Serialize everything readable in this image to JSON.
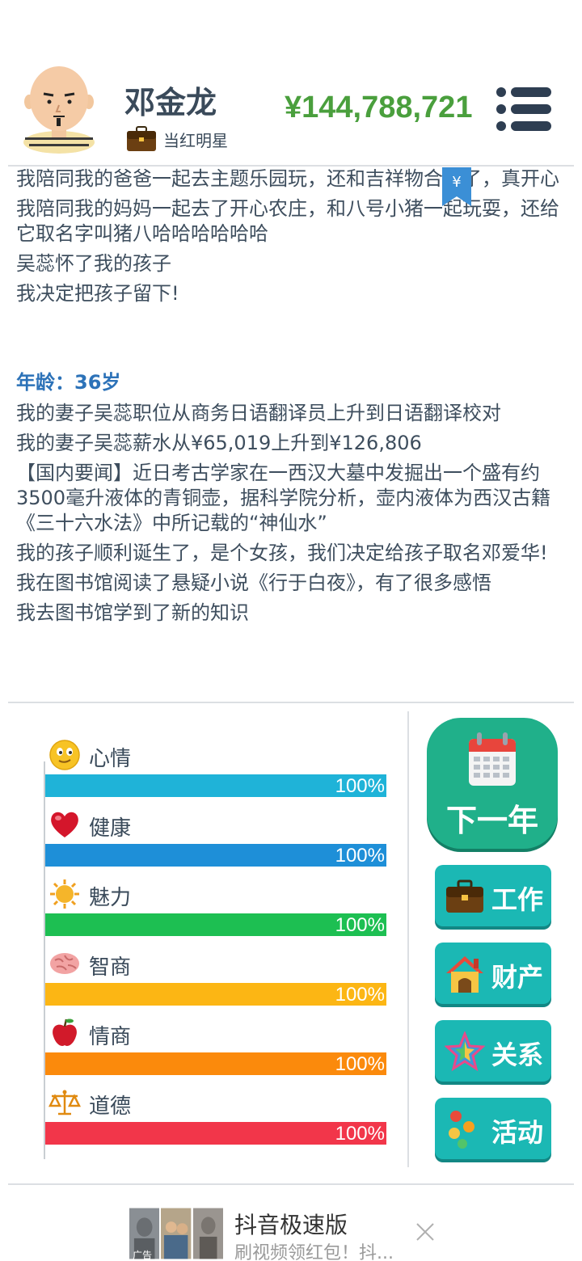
{
  "header": {
    "name": "邓金龙",
    "job_title": "当红明星",
    "money": "¥144,788,721"
  },
  "bookmark_symbol": "¥",
  "log": {
    "entries_before": [
      "我陪同我的爸爸一起去主题乐园玩，还和吉祥物合影了，真开心",
      "我陪同我的妈妈一起去了开心农庄，和八号小猪一起玩耍，还给它取名字叫猪八哈哈哈哈哈哈",
      "吴蕊怀了我的孩子",
      "我决定把孩子留下!"
    ],
    "age_label": "年龄：36岁",
    "entries_after": [
      "我的妻子吴蕊职位从商务日语翻译员上升到日语翻译校对",
      "我的妻子吴蕊薪水从¥65,019上升到¥126,806",
      "【国内要闻】近日考古学家在一西汉大墓中发掘出一个盛有约3500毫升液体的青铜壶，据科学院分析，壶内液体为西汉古籍《三十六水法》中所记载的“神仙水”",
      "我的孩子顺利诞生了，是个女孩，我们决定给孩子取名邓爱华!",
      "我在图书馆阅读了悬疑小说《行于白夜》，有了很多感悟",
      "我去图书馆学到了新的知识"
    ]
  },
  "stats": [
    {
      "name": "心情",
      "value": "100%",
      "fraction": 1.0,
      "color": "#1fb3d8",
      "icon": "smiley-icon"
    },
    {
      "name": "健康",
      "value": "100%",
      "fraction": 1.0,
      "color": "#1e8fd8",
      "icon": "heart-icon"
    },
    {
      "name": "魅力",
      "value": "100%",
      "fraction": 1.0,
      "color": "#1dbf52",
      "icon": "sun-icon"
    },
    {
      "name": "智商",
      "value": "100%",
      "fraction": 1.0,
      "color": "#fcb614",
      "icon": "brain-icon"
    },
    {
      "name": "情商",
      "value": "100%",
      "fraction": 1.0,
      "color": "#fb8a0c",
      "icon": "apple-icon"
    },
    {
      "name": "道德",
      "value": "100%",
      "fraction": 1.0,
      "color": "#f2364a",
      "icon": "scales-icon"
    }
  ],
  "actions": {
    "next_year": "下一年",
    "work": "工作",
    "property": "财产",
    "relations": "关系",
    "activities": "活动"
  },
  "ad": {
    "app_name": "抖音极速版",
    "description": "刷视频领红包！抖...",
    "tag": "广告"
  }
}
